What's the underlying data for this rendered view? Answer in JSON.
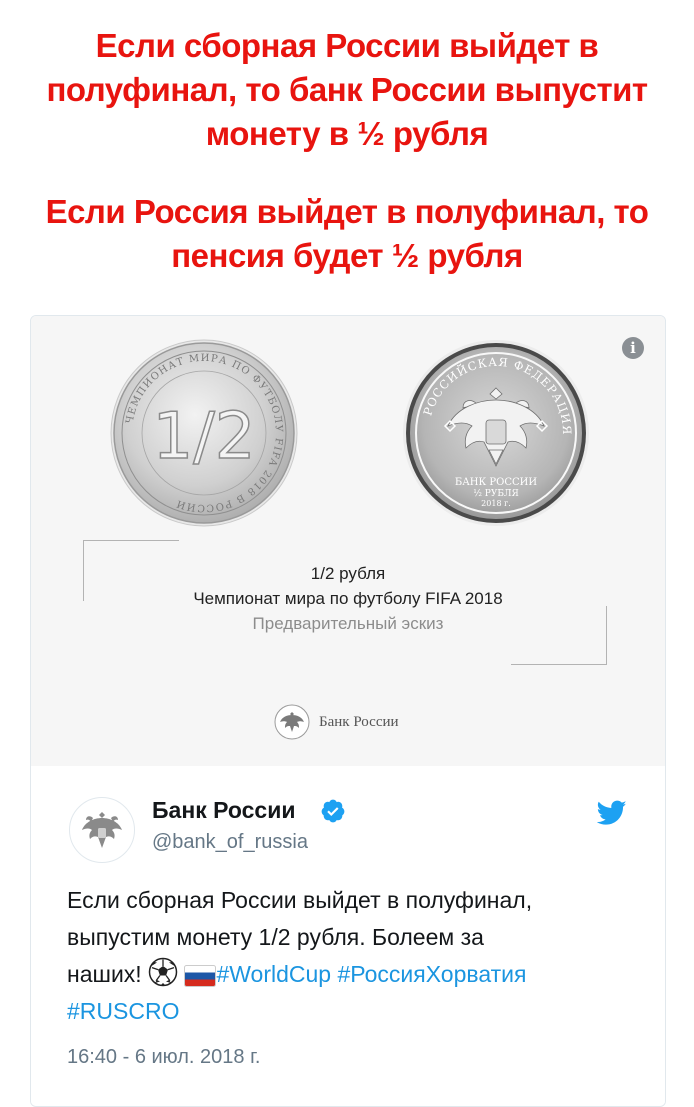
{
  "caption": {
    "line1": "Если сборная России выйдет в",
    "line2": "полуфинал, то банк России выпустит",
    "line3": "монету в ½ рубля",
    "line4": "Если Россия выйдет в полуфинал, то",
    "line5": "пенсия будет ½ рубля"
  },
  "card": {
    "coin_left_value": "1/2",
    "coin_left_ring": "ЧЕМПИОНАТ МИРА ПО ФУТБОЛУ FIFA 2018 В РОССИИ",
    "coin_right_ring": "РОССИЙСКАЯ ФЕДЕРАЦИЯ",
    "coin_right_bank": "БАНК РОССИИ",
    "coin_right_value": "½ РУБЛЯ",
    "coin_right_year": "2018 г.",
    "title": "1/2 рубля",
    "subtitle": "Чемпионат мира по футболу FIFA 2018",
    "note": "Предварительный эскиз",
    "bank_label": "Банк России",
    "info_icon": "i"
  },
  "tweet": {
    "display_name": "Банк России",
    "handle": "@bank_of_russia",
    "text_line1": "Если сборная России выйдет в полуфинал,",
    "text_line2": "выпустим монету 1/2 рубля. Болеем за",
    "text_line3": "наших!",
    "hashtag1": "#WorldCup",
    "hashtag2": "#РоссияХорватия",
    "hashtag3": "#RUSCRO",
    "timestamp": "16:40 - 6 июл. 2018 г.",
    "emojis": [
      "soccer-ball",
      "russia-flag"
    ]
  },
  "colors": {
    "caption": "#e8140f",
    "link": "#1b95e0",
    "verified": "#1da1f2",
    "twitter": "#1da1f2",
    "muted": "#657786"
  }
}
